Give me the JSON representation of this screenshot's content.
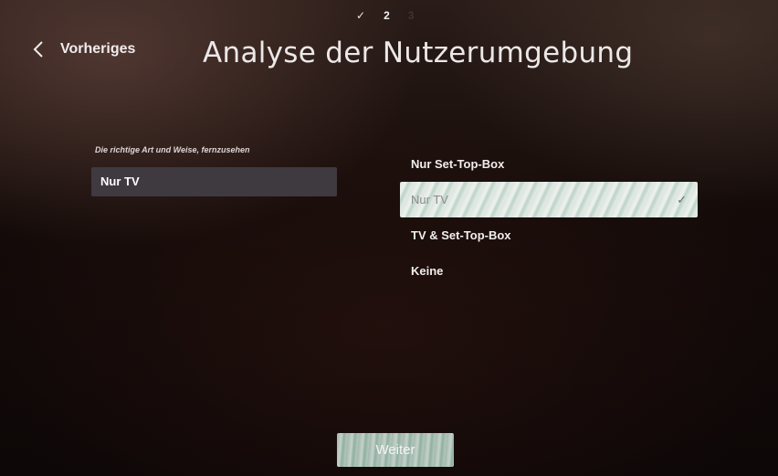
{
  "stepper": {
    "step1": "✓",
    "step2": "2",
    "step3": "3"
  },
  "header": {
    "back_label": "Vorheriges",
    "title": "Analyse der Nutzerumgebung"
  },
  "field": {
    "label": "Die richtige Art und Weise, fernzusehen",
    "value": "Nur TV"
  },
  "options": [
    {
      "label": "Nur Set-Top-Box",
      "selected": false
    },
    {
      "label": "Nur TV",
      "selected": true
    },
    {
      "label": "TV & Set-Top-Box",
      "selected": false
    },
    {
      "label": "Keine",
      "selected": false
    }
  ],
  "check_mark": "✓",
  "footer": {
    "next_label": "Weiter"
  },
  "colors": {
    "field_background": "#3f3a40",
    "selected_option": "#e6ece8",
    "next_button": "#b8c8bf"
  }
}
